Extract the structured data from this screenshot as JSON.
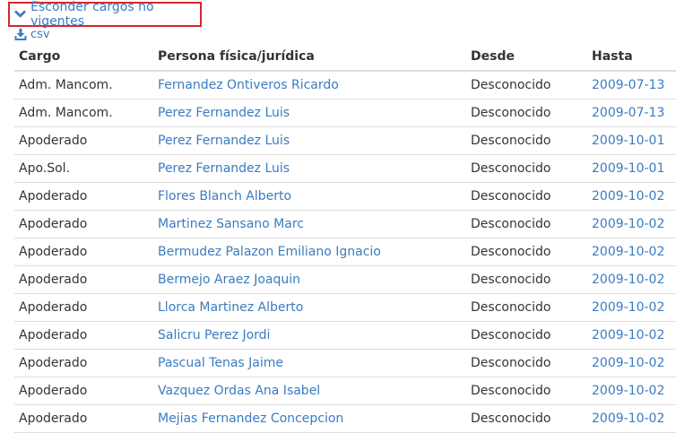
{
  "toggle": {
    "label": "Esconder cargos no vigentes",
    "icon": "chevron-down-icon"
  },
  "export": {
    "label": "csv",
    "icon": "download-icon"
  },
  "table": {
    "headers": [
      "Cargo",
      "Persona física/jurídica",
      "Desde",
      "Hasta"
    ],
    "rows": [
      {
        "cargo": "Adm. Mancom.",
        "persona": "Fernandez Ontiveros Ricardo",
        "desde": "Desconocido",
        "hasta": "2009-07-13"
      },
      {
        "cargo": "Adm. Mancom.",
        "persona": "Perez Fernandez Luis",
        "desde": "Desconocido",
        "hasta": "2009-07-13"
      },
      {
        "cargo": "Apoderado",
        "persona": "Perez Fernandez Luis",
        "desde": "Desconocido",
        "hasta": "2009-10-01"
      },
      {
        "cargo": "Apo.Sol.",
        "persona": "Perez Fernandez Luis",
        "desde": "Desconocido",
        "hasta": "2009-10-01"
      },
      {
        "cargo": "Apoderado",
        "persona": "Flores Blanch Alberto",
        "desde": "Desconocido",
        "hasta": "2009-10-02"
      },
      {
        "cargo": "Apoderado",
        "persona": "Martinez Sansano Marc",
        "desde": "Desconocido",
        "hasta": "2009-10-02"
      },
      {
        "cargo": "Apoderado",
        "persona": "Bermudez Palazon Emiliano Ignacio",
        "desde": "Desconocido",
        "hasta": "2009-10-02"
      },
      {
        "cargo": "Apoderado",
        "persona": "Bermejo Araez Joaquin",
        "desde": "Desconocido",
        "hasta": "2009-10-02"
      },
      {
        "cargo": "Apoderado",
        "persona": "Llorca Martinez Alberto",
        "desde": "Desconocido",
        "hasta": "2009-10-02"
      },
      {
        "cargo": "Apoderado",
        "persona": "Salicru Perez Jordi",
        "desde": "Desconocido",
        "hasta": "2009-10-02"
      },
      {
        "cargo": "Apoderado",
        "persona": "Pascual Tenas Jaime",
        "desde": "Desconocido",
        "hasta": "2009-10-02"
      },
      {
        "cargo": "Apoderado",
        "persona": "Vazquez Ordas Ana Isabel",
        "desde": "Desconocido",
        "hasta": "2009-10-02"
      },
      {
        "cargo": "Apoderado",
        "persona": "Mejias Fernandez Concepcion",
        "desde": "Desconocido",
        "hasta": "2009-10-02"
      }
    ]
  },
  "colors": {
    "link": "#3a7cc0",
    "highlight_border": "#d9262c",
    "text": "#333333",
    "rule": "#dddddd"
  }
}
